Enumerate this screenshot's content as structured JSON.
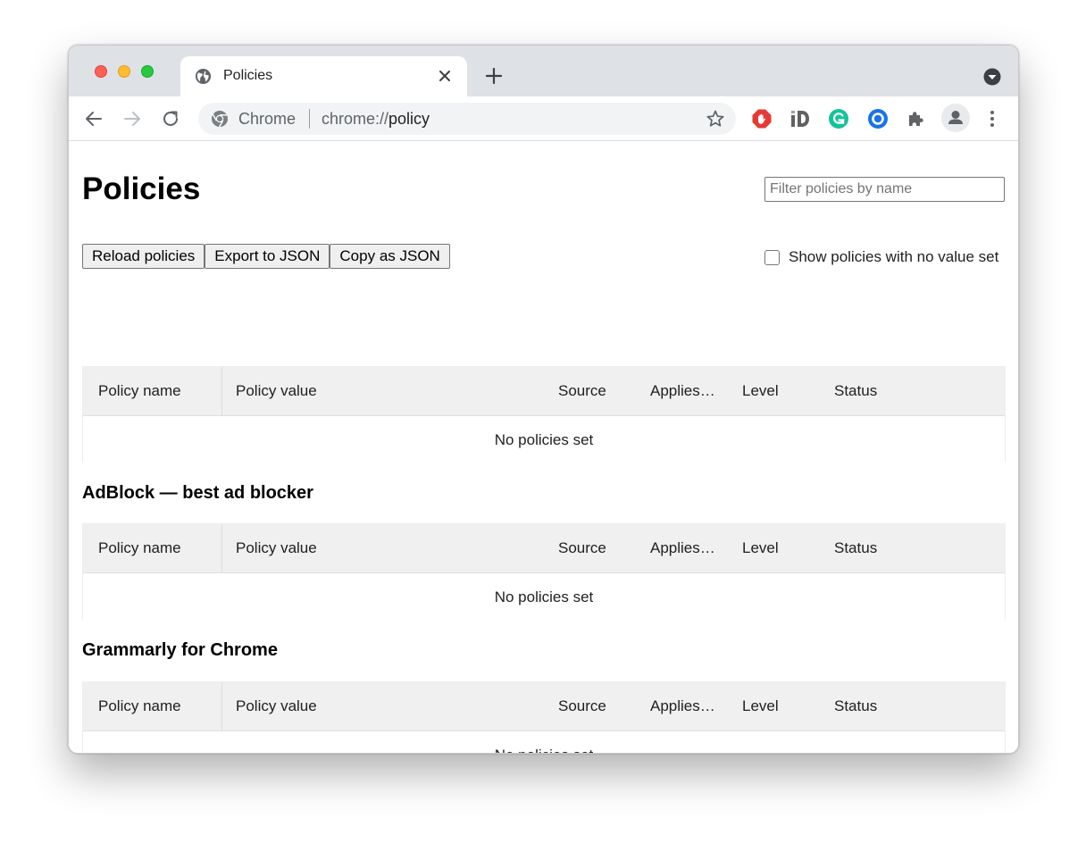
{
  "browser": {
    "tab_title": "Policies",
    "omnibox": {
      "scheme_label": "Chrome",
      "url_prefix": "chrome://",
      "url_host": "policy"
    },
    "icons": {
      "tab_favicon": "globe-icon",
      "tab_close": "close-icon",
      "new_tab": "plus-icon",
      "tab_search": "dropdown-icon",
      "back": "back-arrow-icon",
      "forward": "forward-arrow-icon",
      "reload": "reload-icon",
      "site_info": "chrome-logo-icon",
      "bookmark": "star-icon",
      "extensions": [
        "adblock-icon",
        "id-icon",
        "grammarly-icon",
        "circle-extension-icon",
        "puzzle-icon"
      ],
      "profile": "avatar-icon",
      "menu": "kebab-menu-icon"
    },
    "colors": {
      "traffic_close": "#ff5f57",
      "traffic_min": "#febc2e",
      "traffic_max": "#28c840",
      "adblock": "#e53935",
      "grammarly": "#15c39a",
      "circle_ext": "#1a73e8"
    }
  },
  "page": {
    "title": "Policies",
    "filter_placeholder": "Filter policies by name",
    "buttons": {
      "reload": "Reload policies",
      "export": "Export to JSON",
      "copy": "Copy as JSON"
    },
    "show_unset_label": "Show policies with no value set",
    "columns": {
      "name": "Policy name",
      "value": "Policy value",
      "source": "Source",
      "applies": "Applies…",
      "level": "Level",
      "status": "Status"
    },
    "sections": [
      {
        "title": "",
        "empty_text": "No policies set"
      },
      {
        "title": "AdBlock — best ad blocker",
        "empty_text": "No policies set"
      },
      {
        "title": "Grammarly for Chrome",
        "empty_text": "No policies set"
      }
    ]
  }
}
